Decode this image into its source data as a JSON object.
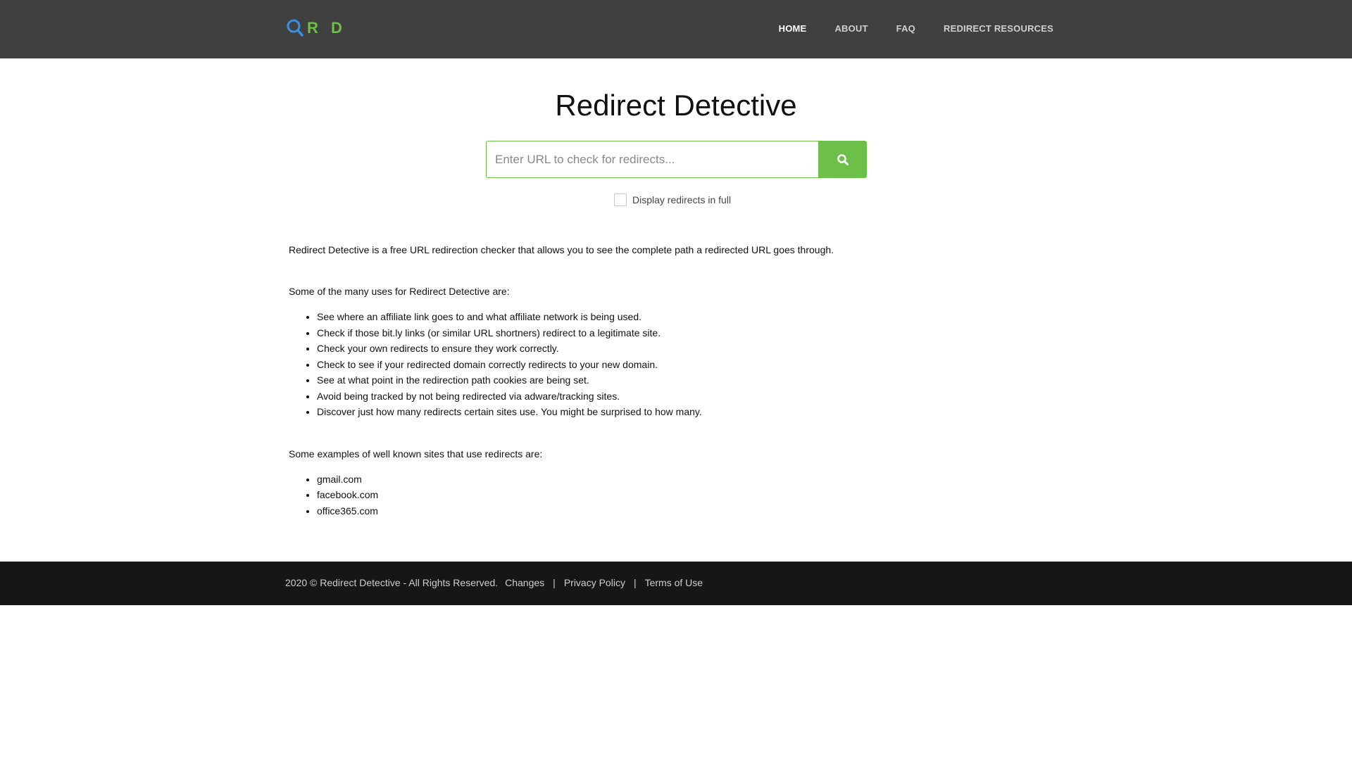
{
  "header": {
    "logo_letters": "R D",
    "nav": [
      {
        "label": "HOME",
        "active": true
      },
      {
        "label": "ABOUT",
        "active": false
      },
      {
        "label": "FAQ",
        "active": false
      },
      {
        "label": "REDIRECT RESOURCES",
        "active": false
      }
    ]
  },
  "main": {
    "title": "Redirect Detective",
    "search": {
      "placeholder": "Enter URL to check for redirects...",
      "value": "",
      "button_icon": "search-icon"
    },
    "display_full_label": "Display redirects in full",
    "display_full_checked": false,
    "intro": "Redirect Detective is a free URL redirection checker that allows you to see the complete path a redirected URL goes through.",
    "uses_heading": "Some of the many uses for Redirect Detective are:",
    "uses": [
      "See where an affiliate link goes to and what affiliate network is being used.",
      "Check if those bit.ly links (or similar URL shortners) redirect to a legitimate site.",
      "Check your own redirects to ensure they work correctly.",
      "Check to see if your redirected domain correctly redirects to your new domain.",
      "See at what point in the redirection path cookies are being set.",
      "Avoid being tracked by not being redirected via adware/tracking sites.",
      "Discover just how many redirects certain sites use. You might be surprised to how many."
    ],
    "examples_heading": "Some examples of well known sites that use redirects are:",
    "examples": [
      "gmail.com",
      "facebook.com",
      "office365.com"
    ]
  },
  "footer": {
    "copyright": "2020 © Redirect Detective - All Rights Reserved.",
    "links": [
      "Changes",
      "Privacy Policy",
      "Terms of Use"
    ],
    "separator": "|"
  },
  "colors": {
    "accent": "#6cc04a",
    "logo_blue": "#3a8ee6",
    "header_bg": "#404040",
    "footer_bg": "#161616"
  }
}
